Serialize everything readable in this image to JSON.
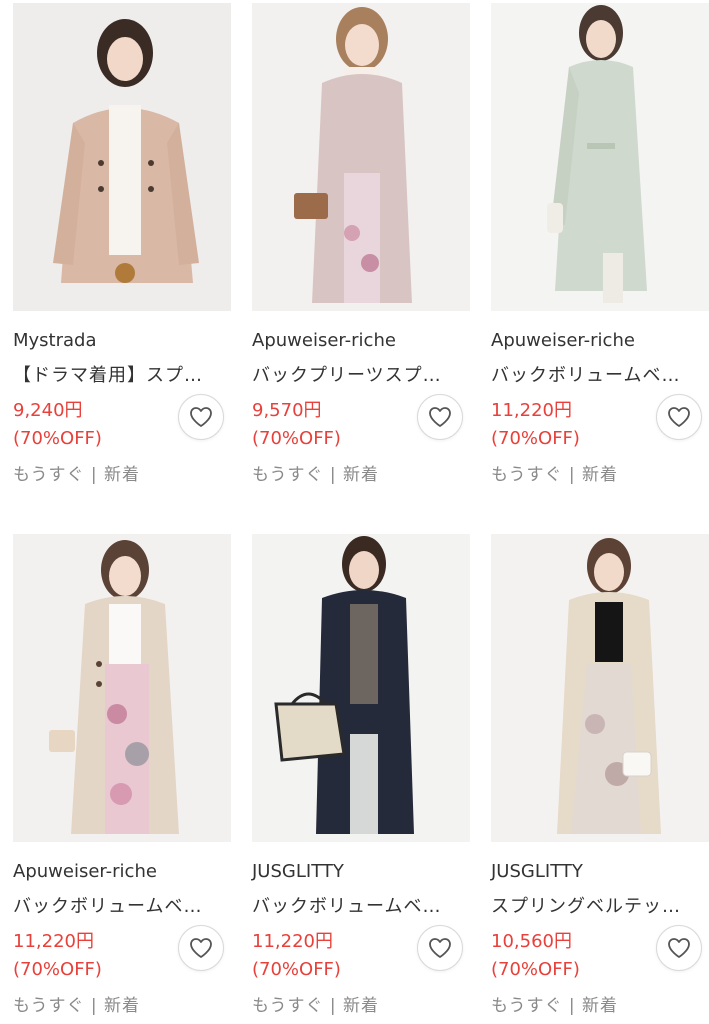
{
  "products": [
    {
      "brand": "Mystrada",
      "title": "【ドラマ着用】スプ…",
      "price": "9,240円",
      "discount": "(70%OFF)",
      "tags": "もうすぐ | 新着"
    },
    {
      "brand": "Apuweiser-riche",
      "title": "バックプリーツスプ…",
      "price": "9,570円",
      "discount": "(70%OFF)",
      "tags": "もうすぐ | 新着"
    },
    {
      "brand": "Apuweiser-riche",
      "title": "バックボリュームベ…",
      "price": "11,220円",
      "discount": "(70%OFF)",
      "tags": "もうすぐ | 新着"
    },
    {
      "brand": "Apuweiser-riche",
      "title": "バックボリュームベ…",
      "price": "11,220円",
      "discount": "(70%OFF)",
      "tags": "もうすぐ | 新着"
    },
    {
      "brand": "JUSGLITTY",
      "title": "バックボリュームベ…",
      "price": "11,220円",
      "discount": "(70%OFF)",
      "tags": "もうすぐ | 新着"
    },
    {
      "brand": "JUSGLITTY",
      "title": "スプリングベルテッ…",
      "price": "10,560円",
      "discount": "(70%OFF)",
      "tags": "もうすぐ | 新着"
    }
  ],
  "colors": {
    "price": "#e8403a",
    "meta": "#8a8a8a"
  },
  "icons": {
    "favorite": "heart-outline-icon"
  }
}
